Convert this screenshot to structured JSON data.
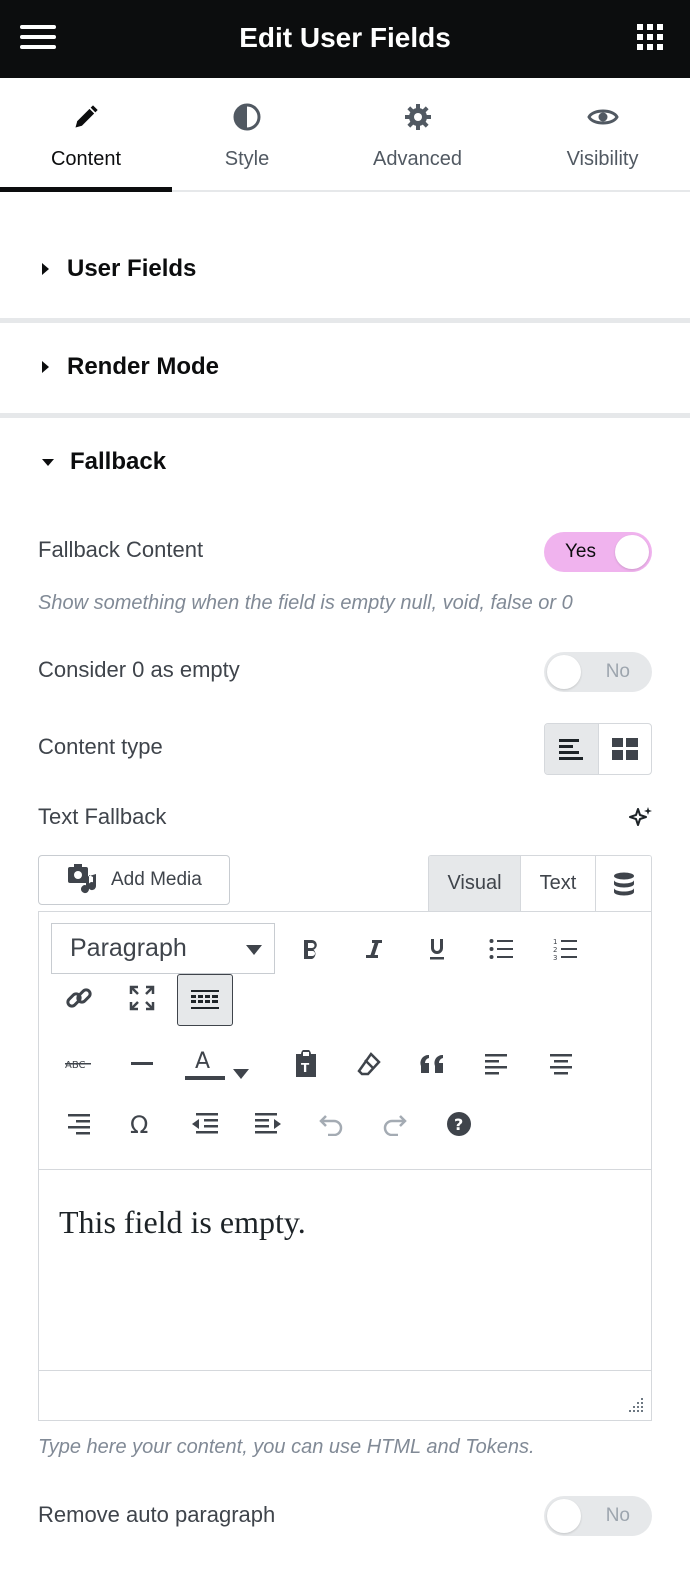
{
  "header": {
    "title": "Edit User Fields",
    "menu_icon": "hamburger-icon",
    "apps_icon": "grid-icon"
  },
  "tabs": [
    {
      "label": "Content",
      "icon": "pencil-icon",
      "active": true
    },
    {
      "label": "Style",
      "icon": "half-circle-icon",
      "active": false
    },
    {
      "label": "Advanced",
      "icon": "gear-icon",
      "active": false
    },
    {
      "label": "Visibility",
      "icon": "eye-icon",
      "active": false
    }
  ],
  "sections": {
    "user_fields": {
      "title": "User Fields",
      "expanded": false
    },
    "render_mode": {
      "title": "Render Mode",
      "expanded": false
    },
    "fallback": {
      "title": "Fallback",
      "expanded": true
    }
  },
  "fallback": {
    "fallback_content": {
      "label": "Fallback Content",
      "toggle_text": "Yes",
      "value": true
    },
    "fallback_help": "Show something when the field is empty null, void, false or 0",
    "consider_zero": {
      "label": "Consider 0 as empty",
      "toggle_text": "No",
      "value": false
    },
    "content_type": {
      "label": "Content type",
      "options": [
        "text-align-icon",
        "blocks-icon"
      ],
      "selected": 0
    },
    "text_fallback": {
      "label": "Text Fallback"
    },
    "add_media_label": "Add Media",
    "editor_tabs": {
      "visual": "Visual",
      "text": "Text"
    },
    "format_select": "Paragraph",
    "editor_content": "This field is empty.",
    "editor_help": "Type here your content, you can use HTML and Tokens.",
    "remove_auto_paragraph": {
      "label": "Remove auto paragraph",
      "toggle_text": "No",
      "value": false
    }
  },
  "colors": {
    "header_bg": "#0c0d0e",
    "toggle_on": "#f0b3ee",
    "toggle_off": "#e6e8ea",
    "text": "#3f444b",
    "help": "#818a96"
  }
}
